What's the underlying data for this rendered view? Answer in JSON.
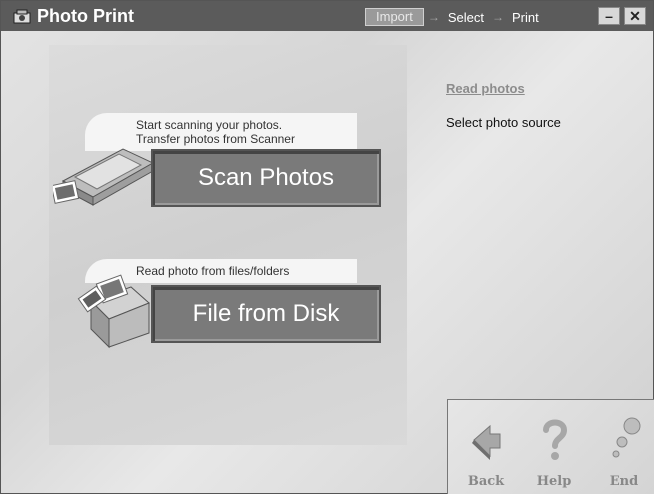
{
  "window": {
    "title": "Photo Print",
    "icon": "photo-print-app-icon"
  },
  "steps": [
    {
      "label": "Import",
      "active": true
    },
    {
      "label": "Select",
      "active": false
    },
    {
      "label": "Print",
      "active": false
    }
  ],
  "step_arrow": "→",
  "window_controls": {
    "minimize": "–",
    "close": "✕"
  },
  "options": [
    {
      "description_line1": "Start scanning your photos.",
      "description_line2": "Transfer photos from Scanner",
      "button_label": "Scan Photos",
      "icon": "scanner-icon"
    },
    {
      "description_line1": "Read photo from files/folders",
      "button_label": "File from Disk",
      "icon": "file-cabinet-icon"
    }
  ],
  "info": {
    "title": "Read photos",
    "text": "Select photo source"
  },
  "nav": {
    "back_label": "Back",
    "help_label": "Help",
    "end_label": "End"
  },
  "colors": {
    "titlebar": "#5b5b5b",
    "button": "#7a7a7a",
    "info_title": "#8c8c8c"
  }
}
